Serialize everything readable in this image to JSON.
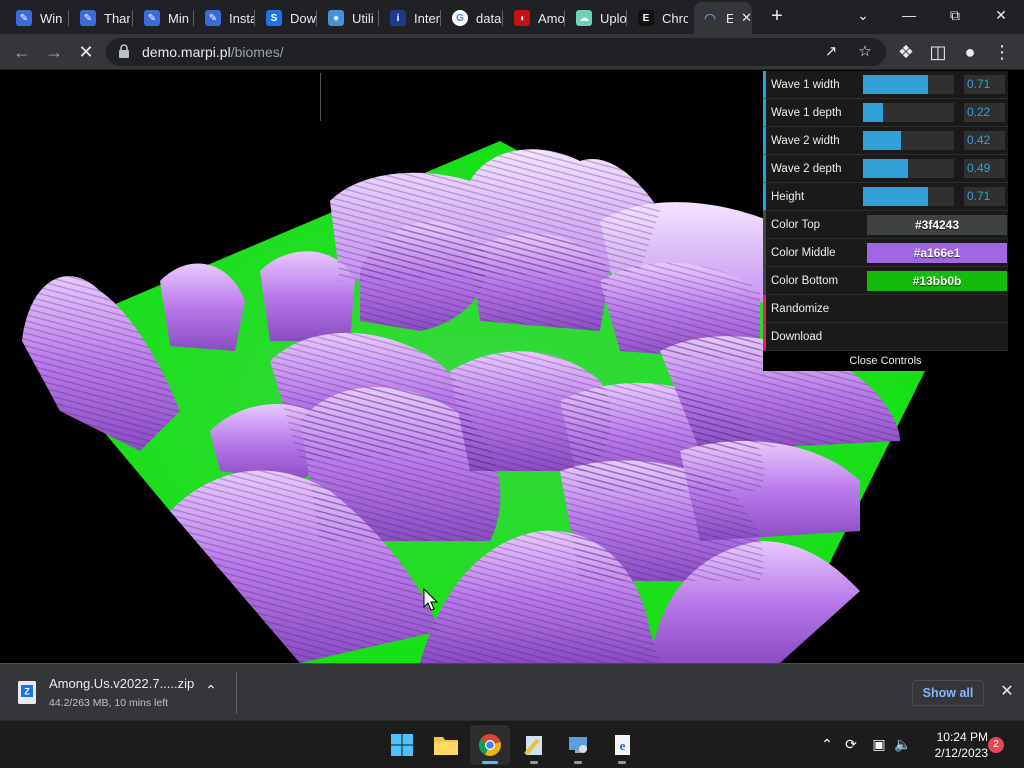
{
  "browser": {
    "tabs": [
      {
        "title": "Win",
        "favicon": "pencil-icon",
        "color": "#3c6ad9"
      },
      {
        "title": "Thar",
        "favicon": "pencil-icon",
        "color": "#3c6ad9"
      },
      {
        "title": "Min",
        "favicon": "pencil-icon",
        "color": "#3c6ad9"
      },
      {
        "title": "Insta",
        "favicon": "pencil-icon",
        "color": "#3c6ad9"
      },
      {
        "title": "Dow",
        "favicon": "steam-icon",
        "color": "#1b74e4"
      },
      {
        "title": "Utili",
        "favicon": "globe-icon",
        "color": "#4a90d9"
      },
      {
        "title": "Inter",
        "favicon": "intel-icon",
        "color": "#1c3a8a"
      },
      {
        "title": "data",
        "favicon": "google-icon",
        "color": "#ffffff"
      },
      {
        "title": "Amo",
        "favicon": "amongus-icon",
        "color": "#c51111"
      },
      {
        "title": "Uplo",
        "favicon": "cloud-icon",
        "color": "#6fd0b8"
      },
      {
        "title": "Chro",
        "favicon": "epic-icon",
        "color": "#111111"
      },
      {
        "title": "E",
        "favicon": "loading-icon",
        "color": "#8ab4f8",
        "active": true
      }
    ],
    "new_tab_label": "+",
    "url_host": "demo.marpi.pl",
    "url_path": "/biomes/"
  },
  "gui": {
    "sliders": [
      {
        "label": "Wave 1 width",
        "value": "0.71",
        "fraction": 0.71
      },
      {
        "label": "Wave 1 depth",
        "value": "0.22",
        "fraction": 0.22
      },
      {
        "label": "Wave 2 width",
        "value": "0.42",
        "fraction": 0.42
      },
      {
        "label": "Wave 2 depth",
        "value": "0.49",
        "fraction": 0.49
      },
      {
        "label": "Height",
        "value": "0.71",
        "fraction": 0.71
      }
    ],
    "colors": [
      {
        "label": "Color Top",
        "value": "#3f4243"
      },
      {
        "label": "Color Middle",
        "value": "#a166e1"
      },
      {
        "label": "Color Bottom",
        "value": "#13bb0b"
      }
    ],
    "functions": [
      {
        "label": "Randomize"
      },
      {
        "label": "Download"
      }
    ],
    "close_label": "Close Controls"
  },
  "download": {
    "filename": "Among.Us.v2022.7.....zip",
    "status": "44.2/263 MB, 10 mins left",
    "show_all": "Show all"
  },
  "taskbar": {
    "apps": [
      "start-icon",
      "file-explorer-icon",
      "chrome-icon",
      "notepad-icon",
      "control-panel-icon",
      "ie-icon"
    ],
    "time": "10:24 PM",
    "date": "2/12/2023",
    "notifications": "2"
  }
}
